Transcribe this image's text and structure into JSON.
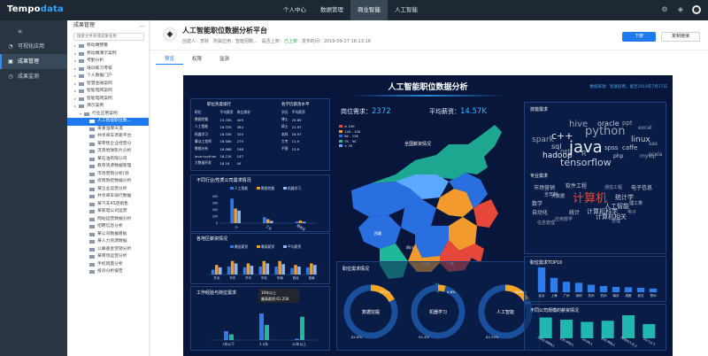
{
  "topbar": {
    "logo_a": "Tempo",
    "logo_b": "data",
    "nav": [
      "个人中心",
      "数据管理",
      "商业智能",
      "人工智能"
    ],
    "active_nav": 2
  },
  "leftnav": {
    "items": [
      {
        "label": "≡",
        "icon": ""
      },
      {
        "label": "可视化应用",
        "icon": "◔"
      },
      {
        "label": "成果管理",
        "icon": "▣"
      },
      {
        "label": "成果监测",
        "icon": "◷"
      }
    ],
    "active": 2
  },
  "tree": {
    "title": "成果管理",
    "search_placeholder": "搜索文件夹或成果名称",
    "items": [
      {
        "label": "移动端预警",
        "type": "folder"
      },
      {
        "label": "移动端演示案例",
        "type": "folder"
      },
      {
        "label": "考勤分析",
        "type": "folder"
      },
      {
        "label": "培训练习考核",
        "type": "folder"
      },
      {
        "label": "个人数据门户",
        "type": "folder"
      },
      {
        "label": "智慧金融案例",
        "type": "folder"
      },
      {
        "label": "智能电网案例",
        "type": "folder"
      },
      {
        "label": "智能电网案例",
        "type": "folder"
      },
      {
        "label": "演示案例",
        "type": "folder"
      },
      {
        "label": "行业应用案例",
        "type": "sub"
      },
      {
        "label": "人工智能职位数...",
        "type": "sel"
      },
      {
        "label": "来重温摩天漫",
        "type": "file"
      },
      {
        "label": "共享单车停靠平台",
        "type": "file"
      },
      {
        "label": "某零售企业经营分",
        "type": "file"
      },
      {
        "label": "流浪地球影片分析",
        "type": "file"
      },
      {
        "label": "某石油有限公司",
        "type": "file"
      },
      {
        "label": "教育资源数据管理",
        "type": "file"
      },
      {
        "label": "市场营销分析(测",
        "type": "file"
      },
      {
        "label": "疫情防控数据分析",
        "type": "file"
      },
      {
        "label": "某企业运营分析",
        "type": "file"
      },
      {
        "label": "共享单车骑行数据",
        "type": "file"
      },
      {
        "label": "某汽车4S店销售",
        "type": "file"
      },
      {
        "label": "某家电公司运营",
        "type": "file"
      },
      {
        "label": "网站运营数据分析",
        "type": "file"
      },
      {
        "label": "招聘信息分析",
        "type": "file"
      },
      {
        "label": "某公司数据看板",
        "type": "file"
      },
      {
        "label": "某人力资源数据",
        "type": "file"
      },
      {
        "label": "公募基金营销分析",
        "type": "file"
      },
      {
        "label": "某商场运营分析",
        "type": "file"
      },
      {
        "label": "手机销量分析",
        "type": "file"
      },
      {
        "label": "投诉分析报告",
        "type": "file"
      }
    ]
  },
  "header": {
    "title": "人工智能职位数据分析平台",
    "creator": "创建人：李默",
    "category": "所属应用：智能招聘...",
    "status_label": "是否上架：",
    "status": "已上架",
    "date": "发布时间：2019-09-27 16:13:16",
    "btn_primary": "下架",
    "btn_secondary": "复制链接"
  },
  "tabs": [
    "预览",
    "权限",
    "监测"
  ],
  "dashboard": {
    "title": "人工智能职位数据分析",
    "subtitle": "数据来源：智联招聘，截至2019年7月17日",
    "kpi1_label": "岗位需求：",
    "kpi1_value": "2372",
    "kpi2_label": "平均薪资：",
    "kpi2_value": "14.57K",
    "table1": {
      "title": "职位热度排行",
      "headers": [
        "职位",
        "平均薪资",
        "岗位需求"
      ],
      "rows": [
        [
          "数据挖掘",
          "15.33K",
          "409"
        ],
        [
          "人工智能",
          "16.37K",
          "384"
        ],
        [
          "机器学习",
          "18.53K",
          "329"
        ],
        [
          "算法工程师",
          "16.58K",
          "279"
        ],
        [
          "数据分析",
          "16.06K",
          "198"
        ],
        [
          "java+python",
          "16.21K",
          "147"
        ],
        [
          "大数据开发",
          "18.1K",
          "44"
        ]
      ]
    },
    "table2": {
      "title": "各学历薪资水平",
      "headers": [
        "学历",
        "平均薪资"
      ],
      "rows": [
        [
          "博士",
          "25.65"
        ],
        [
          "硕士",
          "21.97"
        ],
        [
          "本科",
          "16.97"
        ],
        [
          "大专",
          "11.9"
        ],
        [
          "不限",
          "13.9"
        ]
      ]
    },
    "map_title": "全国薪资情况",
    "map_legend": [
      "≥ 15K",
      "12K - 15K",
      "9K - 12K",
      "7K - 9K",
      "< 7K"
    ],
    "map_legend_colors": [
      "#e5483b",
      "#f39a2e",
      "#2a6fe0",
      "#21b79a",
      "#5aa8ff"
    ],
    "map_cities": [
      "西藏",
      "四川",
      "广东",
      "广西"
    ],
    "pie_title": "职位需求情况",
    "pies": [
      {
        "label": "数据挖掘",
        "pct": "82.8%",
        "small": "17.2%",
        "value": 82.8
      },
      {
        "label": "机器学习",
        "pct": "95.4%",
        "small": "4.6%",
        "value": 95.4
      },
      {
        "label": "人工智能",
        "pct": "83.35%",
        "small": "16.65%",
        "value": 83.35
      }
    ],
    "skills_title": "技能需求",
    "skills": [
      "java",
      "python",
      "c++",
      "spark",
      "hive",
      "hadoop",
      "linux",
      "tensorflow",
      "oracle",
      "sql",
      "php",
      "caffe",
      "R",
      "net",
      "ppt",
      "excel",
      "spss",
      "scala",
      "mysql",
      "sas"
    ],
    "pro_title": "专业需求",
    "pro": [
      "计算机",
      "人工智能",
      "统计学",
      "计算机科学",
      "数学",
      "软件工程",
      "电子信息",
      "自动化",
      "统计",
      "理工类",
      "市场营销",
      "大数据",
      "计算机相关",
      "电子",
      "通信工程",
      "全日制",
      "应用数学",
      "管理",
      "信息管理"
    ],
    "chart_data": [
      {
        "type": "bar",
        "title": "不同行业/性质公司需求情况",
        "categories": [
          "IT",
          "工业",
          "服务业"
        ],
        "series": [
          {
            "name": "人工智能",
            "values": [
              370,
              90,
              25
            ]
          },
          {
            "name": "数据挖掘",
            "values": [
              220,
              60,
              40
            ]
          },
          {
            "name": "机器学习",
            "values": [
              190,
              35,
              20
            ]
          }
        ],
        "ylim": [
          0,
          400
        ],
        "yticks": [
          "400",
          "300",
          "200",
          "100",
          "0"
        ]
      },
      {
        "type": "bar",
        "title": "各地区薪资情况",
        "categories": [
          "东北",
          "华东",
          "华中",
          "华北",
          "华南",
          "西北",
          "西南"
        ],
        "series": [
          {
            "name": "最低薪资",
            "values": [
              6,
              10,
              9,
              10,
              10,
              8,
              9
            ]
          },
          {
            "name": "最高薪资",
            "values": [
              12,
              17,
              14,
              17,
              17,
              12,
              14
            ]
          },
          {
            "name": "平均薪资",
            "values": [
              9,
              14,
              11,
              14,
              13,
              10,
              12
            ]
          }
        ],
        "ylim": [
          0,
          20
        ]
      },
      {
        "type": "bar",
        "title": "工作经验与岗位需求",
        "categories": [
          "1年以下",
          "3-5年",
          "10年以上"
        ],
        "series": [
          {
            "name": "岗位需求",
            "values": [
              200,
              600,
              30
            ]
          },
          {
            "name": "最高薪资",
            "values": [
              15,
              40,
              61.25
            ]
          }
        ],
        "tooltip": [
          "10年以上",
          "最高薪资:61.25K"
        ]
      },
      {
        "type": "bar",
        "title": "职位需求TOP10",
        "categories": [
          "北京",
          "上海",
          "广州",
          "深圳",
          "苏州",
          "杭州",
          "南京",
          "成都",
          "武汉",
          "郑州"
        ],
        "values": [
          1000,
          580,
          420,
          380,
          300,
          250,
          220,
          200,
          180,
          150
        ]
      },
      {
        "type": "bar",
        "title": "不同公司规模的薪资情况",
        "categories": [
          "1000-9999人",
          "100-499人",
          "20-99人",
          "500-999人",
          "10000人以上",
          "20人以下"
        ],
        "values": [
          19,
          17,
          15,
          16,
          21,
          13
        ]
      }
    ]
  }
}
